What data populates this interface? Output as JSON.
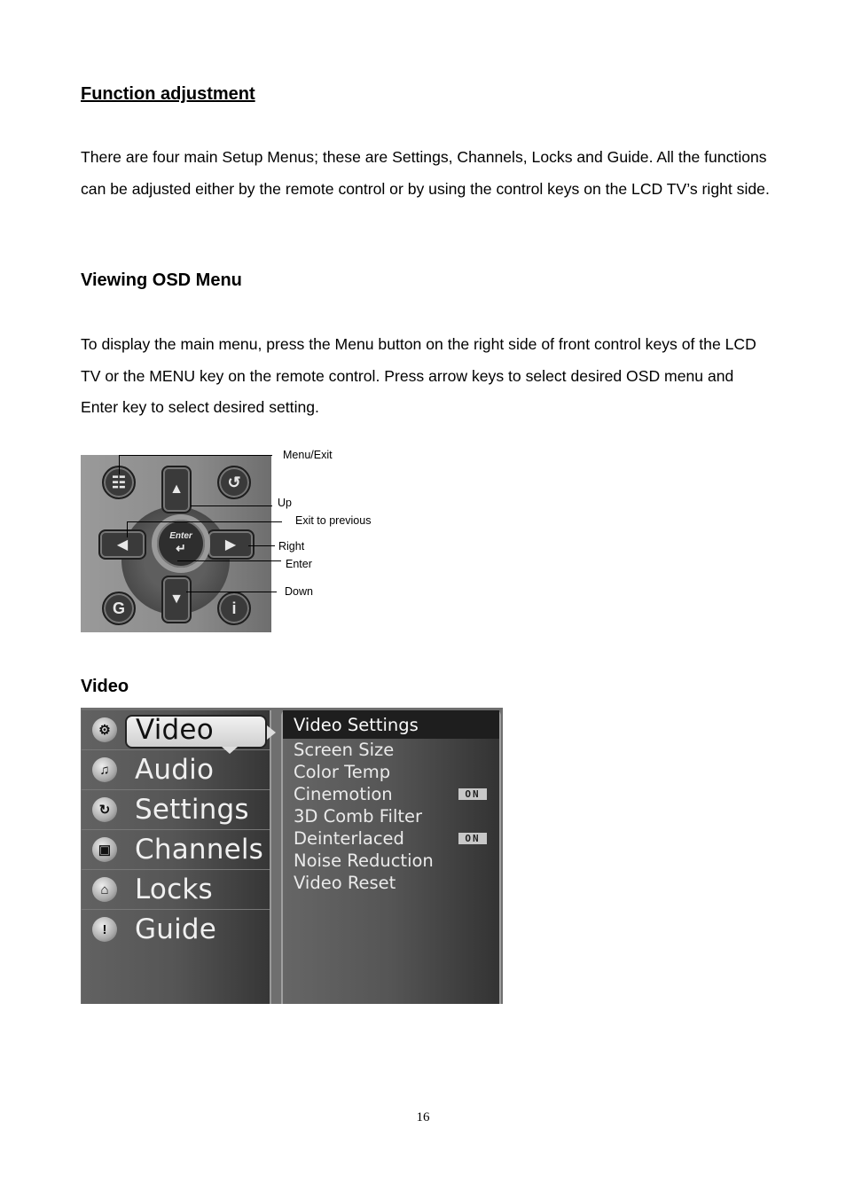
{
  "page": {
    "heading": "Function adjustment",
    "intro": "There are four main Setup Menus; these are Settings, Channels, Locks and Guide. All the functions can be adjusted either by the remote control or by using the control keys on the LCD TV’s right side.",
    "osd_heading": "Viewing OSD Menu",
    "osd_text": "To display the main menu, press the Menu button on the right side of front control keys of the LCD TV or the MENU key on the remote control. Press arrow keys to select desired OSD menu and Enter key to select desired setting.",
    "video_heading": "Video",
    "page_number": "16"
  },
  "remote": {
    "enter_text": "Enter",
    "labels": {
      "menu_exit": "Menu/Exit",
      "up": "Up",
      "exit_previous": "Exit to previous",
      "right": "Right",
      "enter": "Enter",
      "down": "Down"
    },
    "glyphs": {
      "menu": "☷",
      "back": "↺",
      "guide": "G",
      "info": "i",
      "up": "▲",
      "down": "▼",
      "left": "◀",
      "right": "▶",
      "enter_key": "↵"
    }
  },
  "osd": {
    "main_menu": [
      {
        "label": "Video",
        "icon": "gear-icon",
        "glyph": "⚙",
        "selected": true
      },
      {
        "label": "Audio",
        "icon": "speaker-icon",
        "glyph": "♫"
      },
      {
        "label": "Settings",
        "icon": "settings-icon",
        "glyph": "↻"
      },
      {
        "label": "Channels",
        "icon": "tv-icon",
        "glyph": "▣"
      },
      {
        "label": "Locks",
        "icon": "lock-icon",
        "glyph": "⌂"
      },
      {
        "label": "Guide",
        "icon": "exclamation-icon",
        "glyph": "!"
      }
    ],
    "submenu": {
      "title": "Video Settings",
      "items": [
        {
          "label": "Screen Size",
          "value": ""
        },
        {
          "label": "Color Temp",
          "value": ""
        },
        {
          "label": "Cinemotion",
          "value": "ON"
        },
        {
          "label": "3D Comb Filter",
          "value": ""
        },
        {
          "label": "Deinterlaced",
          "value": "ON"
        },
        {
          "label": "Noise Reduction",
          "value": ""
        },
        {
          "label": "Video Reset",
          "value": ""
        }
      ]
    }
  }
}
